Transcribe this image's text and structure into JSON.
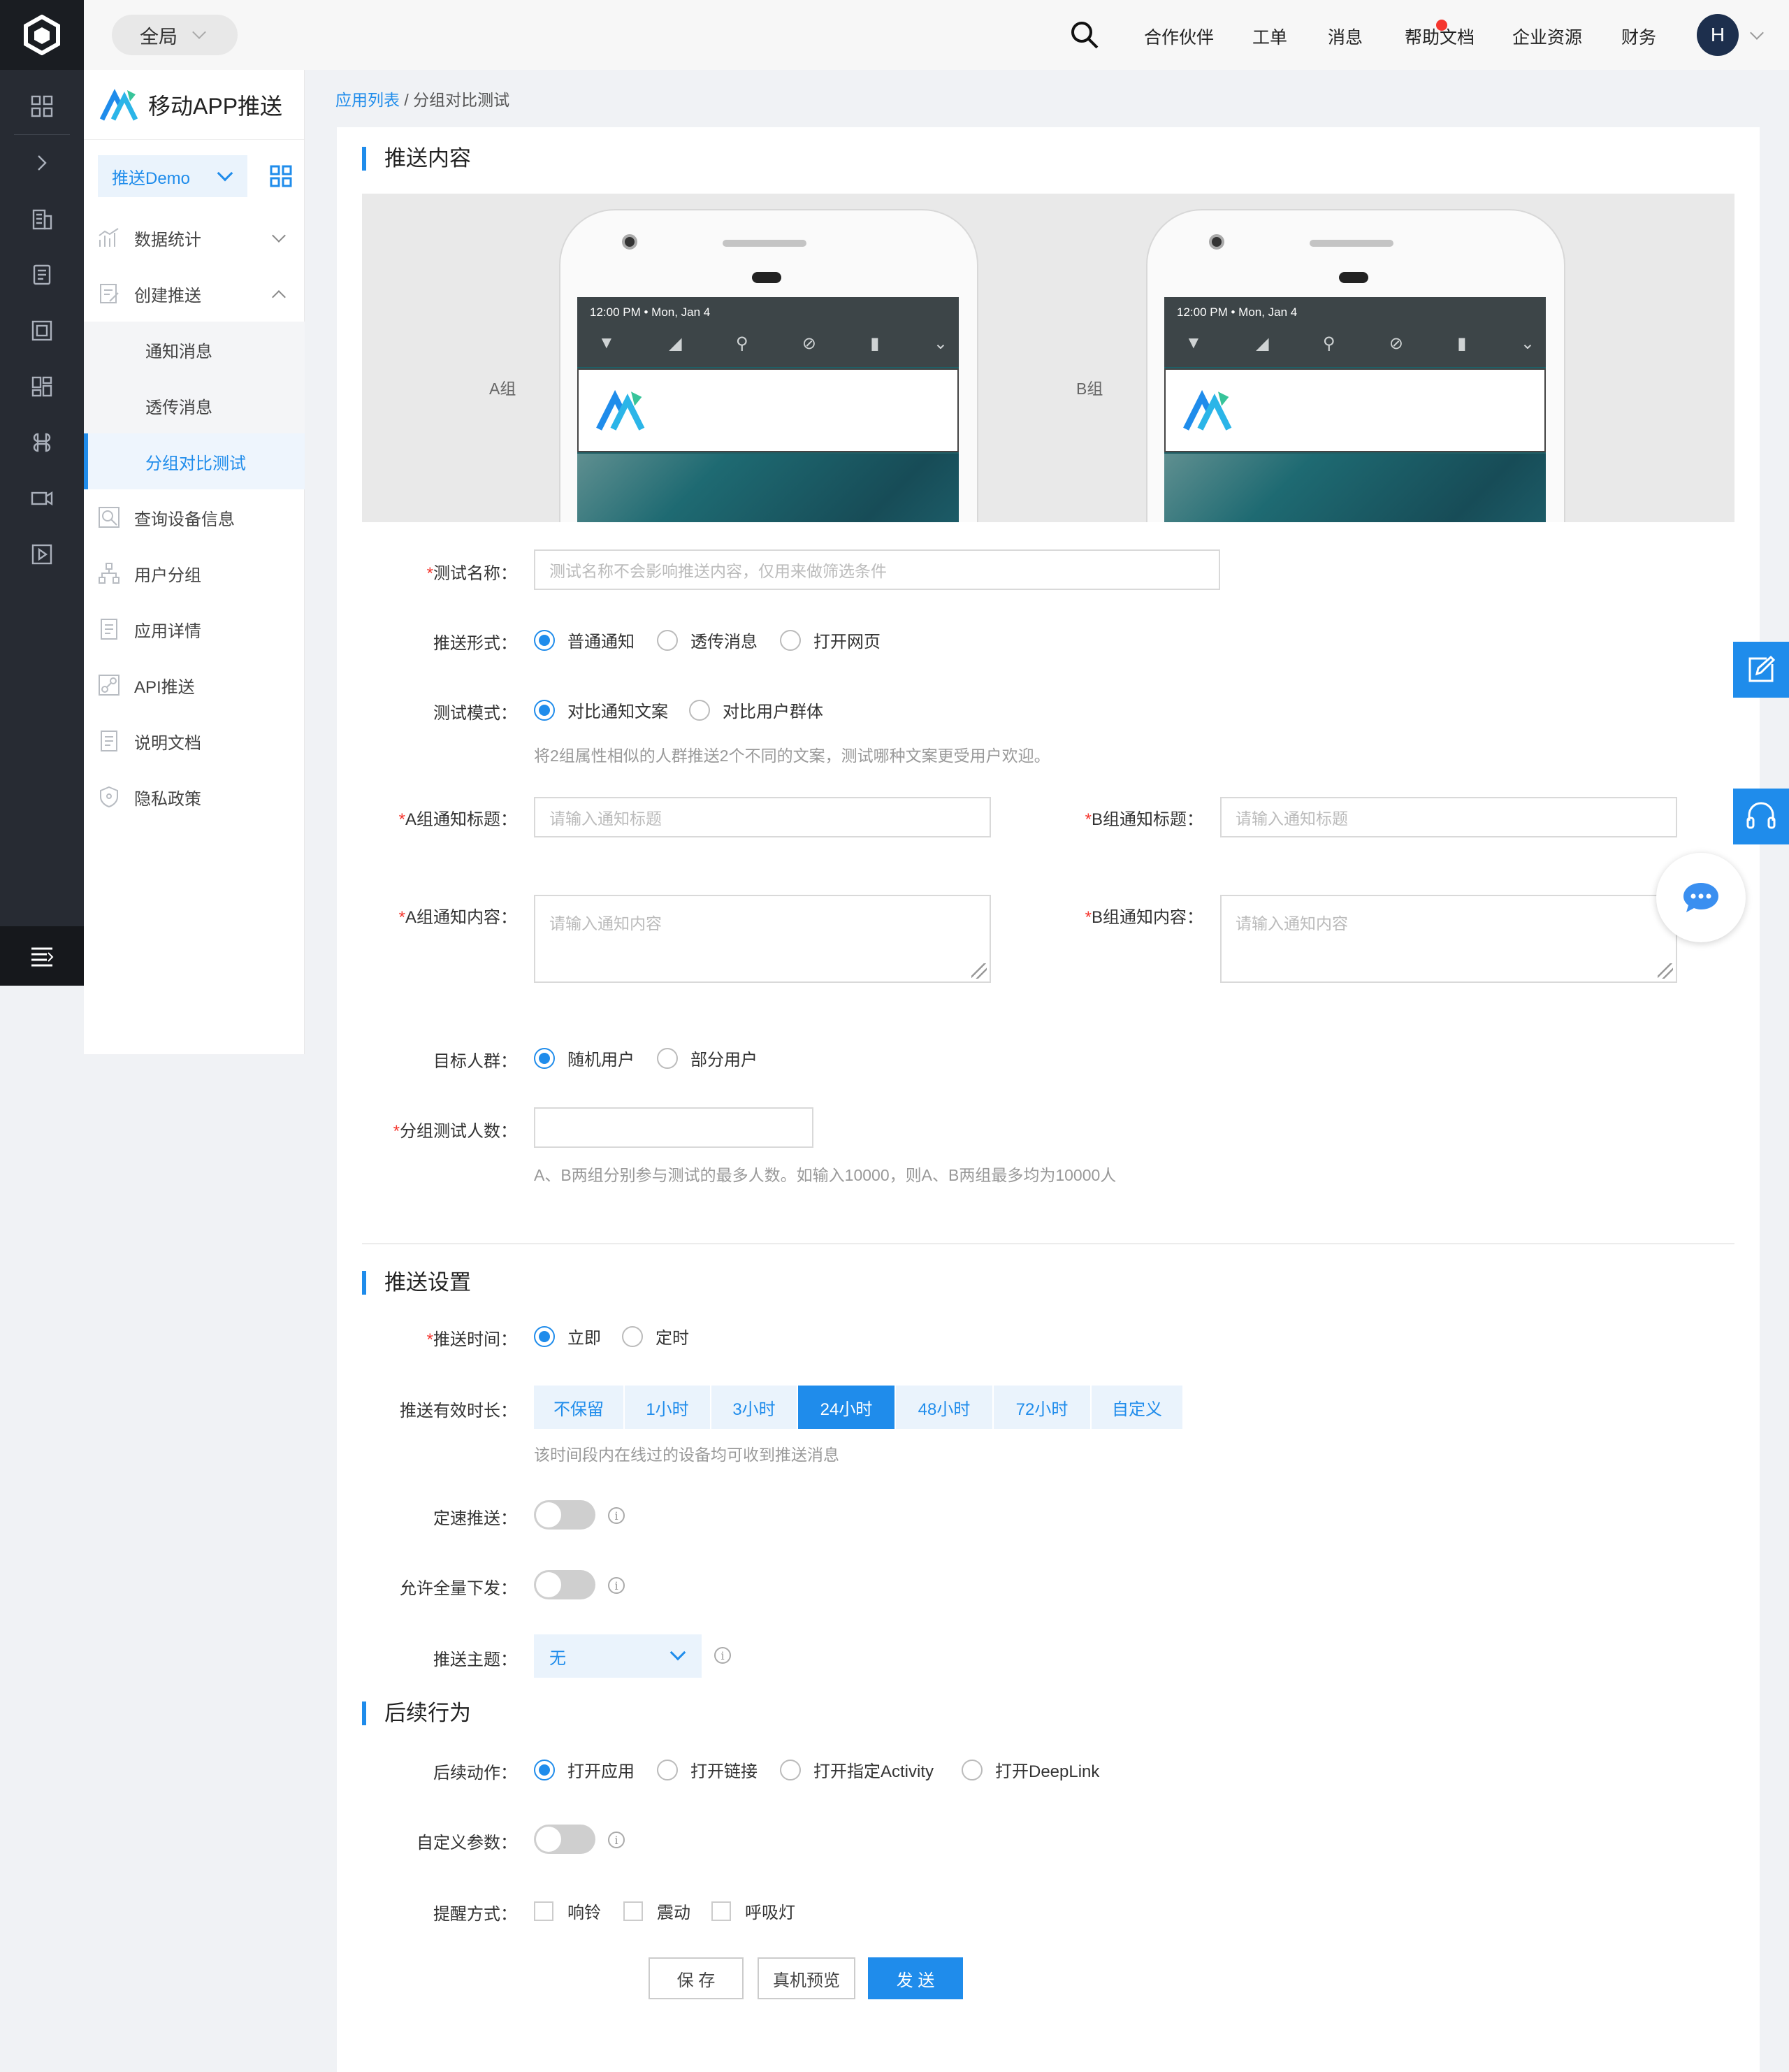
{
  "topbar": {
    "scope": "全局",
    "nav": [
      "合作伙伴",
      "工单",
      "消息",
      "帮助文档",
      "企业资源",
      "财务"
    ],
    "avatar": "H"
  },
  "sidebar": {
    "product_name": "移动APP推送",
    "app_select": "推送Demo",
    "items": [
      {
        "label": "数据统计",
        "icon": "chart-icon"
      },
      {
        "label": "创建推送",
        "icon": "edit-doc-icon"
      },
      {
        "label": "通知消息"
      },
      {
        "label": "透传消息"
      },
      {
        "label": "分组对比测试"
      },
      {
        "label": "查询设备信息",
        "icon": "search-device-icon"
      },
      {
        "label": "用户分组",
        "icon": "org-tree-icon"
      },
      {
        "label": "应用详情",
        "icon": "doc-icon"
      },
      {
        "label": "API推送",
        "icon": "link-icon"
      },
      {
        "label": "说明文档",
        "icon": "doc-icon"
      },
      {
        "label": "隐私政策",
        "icon": "shield-icon"
      }
    ]
  },
  "breadcrumb": {
    "link": "应用列表",
    "sep": " / ",
    "current": "分组对比测试"
  },
  "section_content": {
    "title": "推送内容",
    "group_a": "A组",
    "group_b": "B组",
    "phone_time": "12:00 PM  •  Mon, Jan 4"
  },
  "form": {
    "test_name": {
      "label": "测试名称：",
      "placeholder": "测试名称不会影响推送内容，仅用来做筛选条件"
    },
    "push_form": {
      "label": "推送形式：",
      "options": [
        "普通通知",
        "透传消息",
        "打开网页"
      ]
    },
    "test_mode": {
      "label": "测试模式：",
      "options": [
        "对比通知文案",
        "对比用户群体"
      ],
      "hint": "将2组属性相似的人群推送2个不同的文案，测试哪种文案更受用户欢迎。"
    },
    "a_title": {
      "label": "A组通知标题：",
      "placeholder": "请输入通知标题"
    },
    "b_title": {
      "label": "B组通知标题：",
      "placeholder": "请输入通知标题"
    },
    "a_content": {
      "label": "A组通知内容：",
      "placeholder": "请输入通知内容"
    },
    "b_content": {
      "label": "B组通知内容：",
      "placeholder": "请输入通知内容"
    },
    "target": {
      "label": "目标人群：",
      "options": [
        "随机用户",
        "部分用户"
      ]
    },
    "test_count": {
      "label": "分组测试人数：",
      "hint": "A、B两组分别参与测试的最多人数。如输入10000，则A、B两组最多均为10000人"
    }
  },
  "section_settings": {
    "title": "推送设置",
    "push_time": {
      "label": "推送时间：",
      "options": [
        "立即",
        "定时"
      ]
    },
    "validity": {
      "label": "推送有效时长：",
      "options": [
        "不保留",
        "1小时",
        "3小时",
        "24小时",
        "48小时",
        "72小时",
        "自定义"
      ],
      "hint": "该时间段内在线过的设备均可收到推送消息"
    },
    "rate_push": {
      "label": "定速推送："
    },
    "allow_full": {
      "label": "允许全量下发："
    },
    "topic": {
      "label": "推送主题：",
      "value": "无"
    }
  },
  "section_follow": {
    "title": "后续行为",
    "action": {
      "label": "后续动作：",
      "options": [
        "打开应用",
        "打开链接",
        "打开指定Activity",
        "打开DeepLink"
      ]
    },
    "custom_params": {
      "label": "自定义参数："
    },
    "remind": {
      "label": "提醒方式：",
      "options": [
        "响铃",
        "震动",
        "呼吸灯"
      ]
    }
  },
  "buttons": {
    "save": "保 存",
    "preview": "真机预览",
    "send": "发 送"
  },
  "colors": {
    "accent": "#1f8ceb",
    "rail": "#272b33",
    "required": "#f5362e"
  }
}
